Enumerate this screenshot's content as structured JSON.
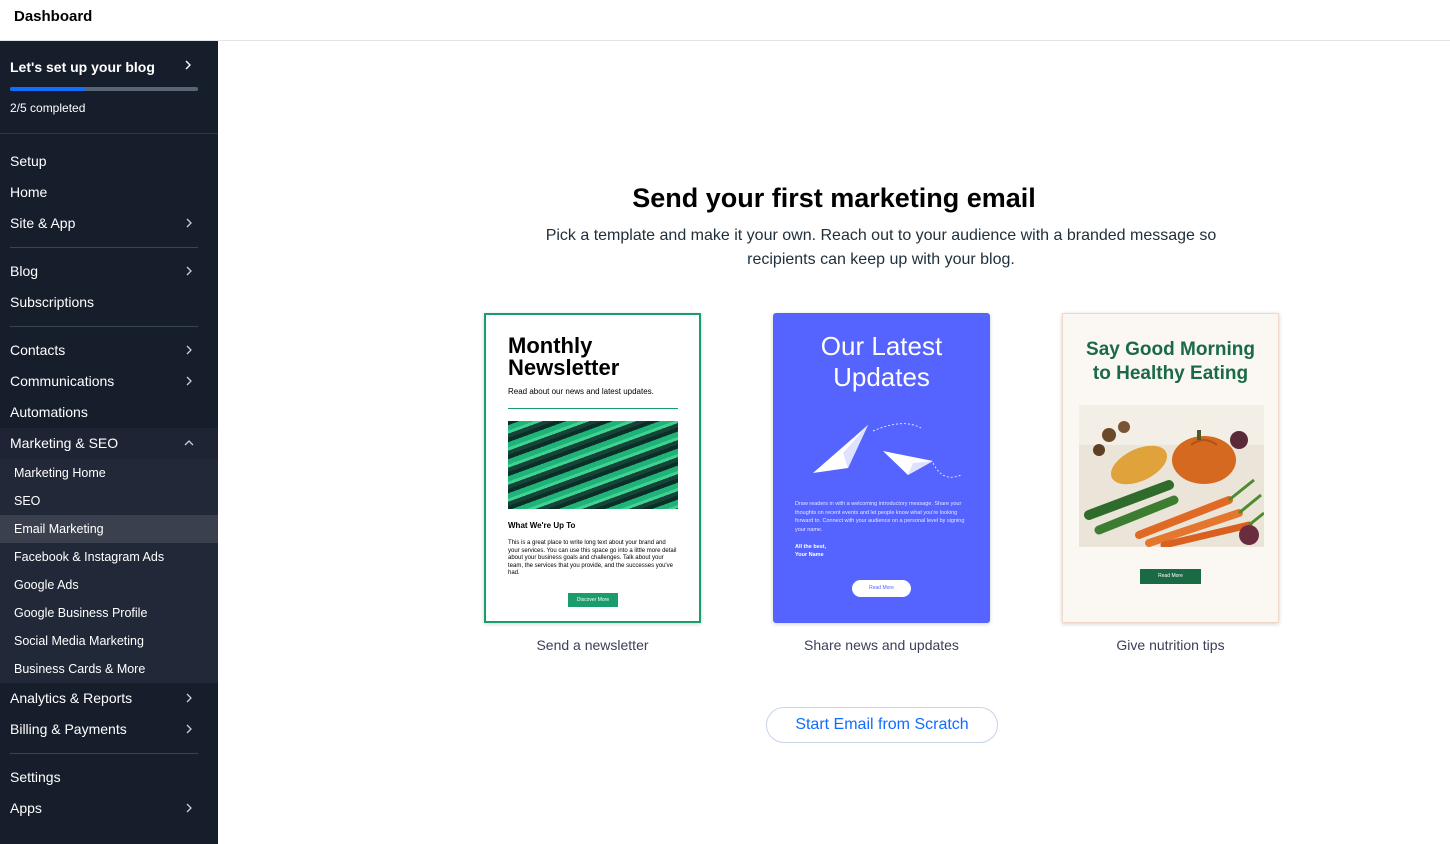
{
  "topbar": {
    "title": "Dashboard"
  },
  "sidebar": {
    "setup": {
      "title": "Let's set up your blog",
      "progress_text": "2/5 completed",
      "progress_fraction": 0.4
    },
    "items": [
      {
        "label": "Setup"
      },
      {
        "label": "Home"
      },
      {
        "label": "Site & App"
      },
      {
        "label": "Blog"
      },
      {
        "label": "Subscriptions"
      },
      {
        "label": "Contacts"
      },
      {
        "label": "Communications"
      },
      {
        "label": "Automations"
      },
      {
        "label": "Marketing & SEO"
      },
      {
        "label": "Analytics & Reports"
      },
      {
        "label": "Billing & Payments"
      },
      {
        "label": "Settings"
      },
      {
        "label": "Apps"
      }
    ],
    "marketing_sub": [
      {
        "label": "Marketing Home"
      },
      {
        "label": "SEO"
      },
      {
        "label": "Email Marketing"
      },
      {
        "label": "Facebook & Instagram Ads"
      },
      {
        "label": "Google Ads"
      },
      {
        "label": "Google Business Profile"
      },
      {
        "label": "Social Media Marketing"
      },
      {
        "label": "Business Cards & More"
      }
    ]
  },
  "main": {
    "headline": "Send your first marketing email",
    "subline": "Pick a template and make it your own. Reach out to your audience with a branded message so recipients can keep up with your blog.",
    "cards": [
      {
        "title_line1": "Monthly",
        "title_line2": "Newsletter",
        "intro": "Read about our news and latest updates.",
        "section_title": "What We're Up To",
        "body": "This is a great place to write long text about your brand and your services. You can use this space go into a little more detail about your business goals and challenges. Talk about your team, the services that you provide, and the successes you've had.",
        "button": "Discover More",
        "caption": "Send a newsletter",
        "accent": "#1a9d6b"
      },
      {
        "title_line1": "Our Latest",
        "title_line2": "Updates",
        "body": "Draw readers in with a welcoming introductory message. Share your thoughts on recent events and let people know what you're looking forward to. Connect with your audience on a personal level by signing your name.",
        "sig_line1": "All the best,",
        "sig_line2": "Your Name",
        "button": "Read More",
        "caption": "Share news and updates",
        "accent": "#5563ff"
      },
      {
        "title_line1": "Say Good Morning",
        "title_line2": "to Healthy Eating",
        "button": "Read More",
        "caption": "Give nutrition tips",
        "accent": "#1a6a45"
      }
    ],
    "scratch_button": "Start Email from Scratch"
  }
}
